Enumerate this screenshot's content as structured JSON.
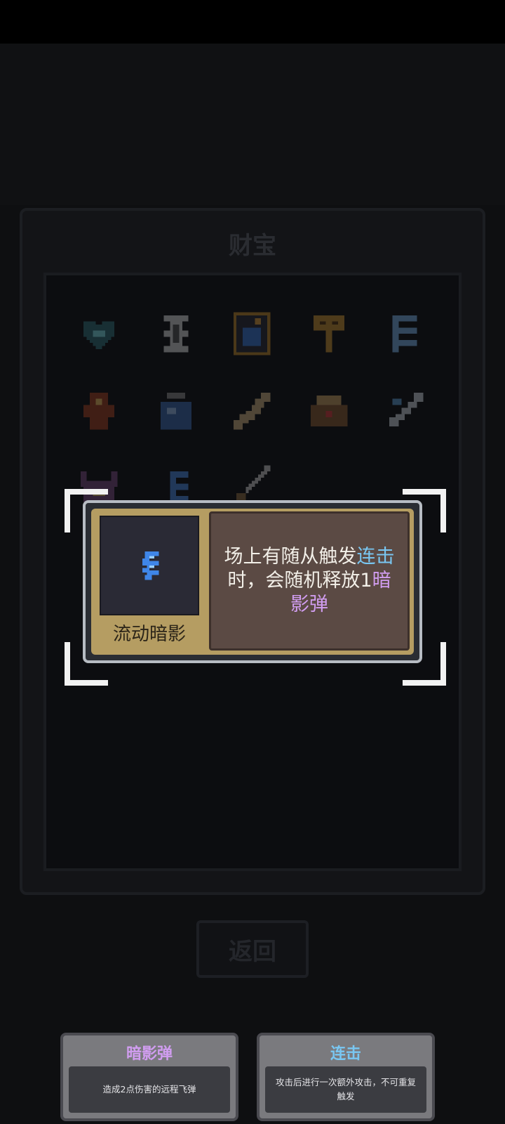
{
  "treasure_panel": {
    "title": "财宝",
    "items": [
      {
        "icon": "heart-gem-icon"
      },
      {
        "icon": "hourglass-icon"
      },
      {
        "icon": "bomb-card-icon"
      },
      {
        "icon": "key-icon"
      },
      {
        "icon": "wind-swirl-icon"
      },
      {
        "icon": "idol-icon"
      },
      {
        "icon": "potion-jar-icon"
      },
      {
        "icon": "bone-icon"
      },
      {
        "icon": "chest-icon"
      },
      {
        "icon": "feather-sword-icon"
      },
      {
        "icon": "horned-helmet-icon"
      },
      {
        "icon": "shadow-flow-icon"
      },
      {
        "icon": "dagger-icon"
      }
    ]
  },
  "back_button": {
    "label": "返回"
  },
  "selected_item": {
    "name": "流动暗影",
    "icon": "shadow-flow-icon",
    "desc_part1": "场上有随从触发",
    "desc_kw1": "连击",
    "desc_part2": "时，会随机释放1",
    "desc_kw2": "暗影弹"
  },
  "keyword_tooltips": [
    {
      "title": "暗影弹",
      "color": "#d19df0",
      "body": "造成2点伤害的远程飞弹"
    },
    {
      "title": "连击",
      "color": "#79c7f2",
      "body": "攻击后进行一次额外攻击，不可重复触发"
    }
  ]
}
